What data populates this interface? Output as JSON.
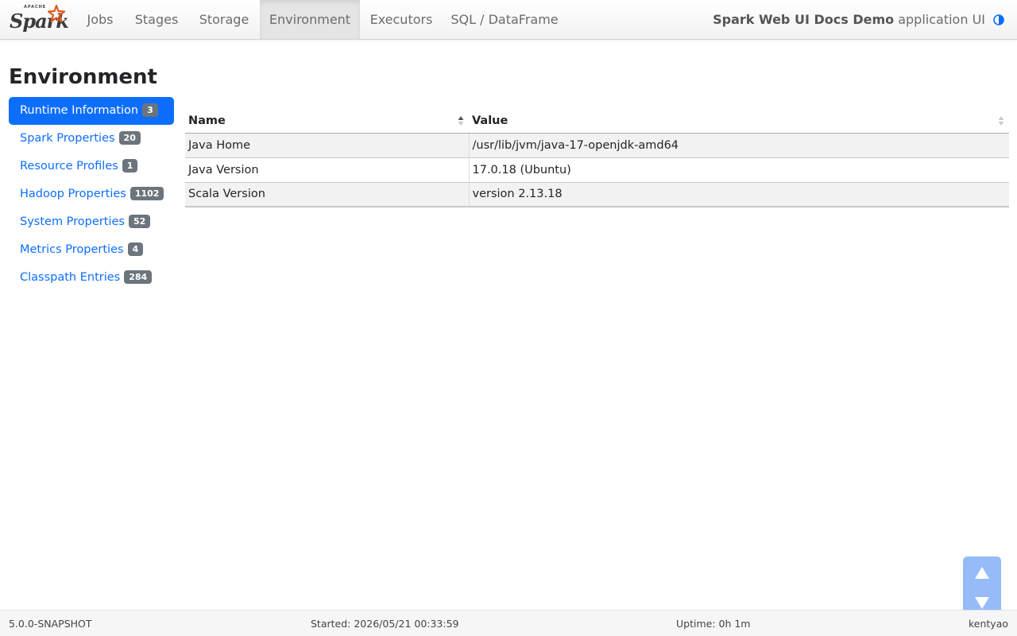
{
  "navbar": {
    "brand_apache": "APACHE",
    "brand_word": "Spark",
    "tabs": [
      {
        "label": "Jobs"
      },
      {
        "label": "Stages"
      },
      {
        "label": "Storage"
      },
      {
        "label": "Environment"
      },
      {
        "label": "Executors"
      },
      {
        "label": "SQL / DataFrame"
      }
    ],
    "active_tab": "Environment",
    "app_name": "Spark Web UI Docs Demo",
    "app_suffix": "application UI",
    "theme_icon": "contrast-icon"
  },
  "page": {
    "title": "Environment"
  },
  "sidebar": {
    "items": [
      {
        "label": "Runtime Information",
        "count": "3",
        "active": true
      },
      {
        "label": "Spark Properties",
        "count": "20"
      },
      {
        "label": "Resource Profiles",
        "count": "1"
      },
      {
        "label": "Hadoop Properties",
        "count": "1102"
      },
      {
        "label": "System Properties",
        "count": "52"
      },
      {
        "label": "Metrics Properties",
        "count": "4"
      },
      {
        "label": "Classpath Entries",
        "count": "284"
      }
    ]
  },
  "table": {
    "headers": [
      "Name",
      "Value"
    ],
    "rows": [
      [
        "Java Home",
        "/usr/lib/jvm/java-17-openjdk-amd64"
      ],
      [
        "Java Version",
        "17.0.18 (Ubuntu)"
      ],
      [
        "Scala Version",
        "version 2.13.18"
      ]
    ]
  },
  "footer": {
    "version": "5.0.0-SNAPSHOT",
    "started": "Started: 2026/05/21 00:33:59",
    "uptime": "Uptime: 0h 1m",
    "user": "kentyao"
  },
  "colors": {
    "accent": "#0d6efd",
    "badge": "#6c757d",
    "scroll_button": "#8ab4f8"
  }
}
